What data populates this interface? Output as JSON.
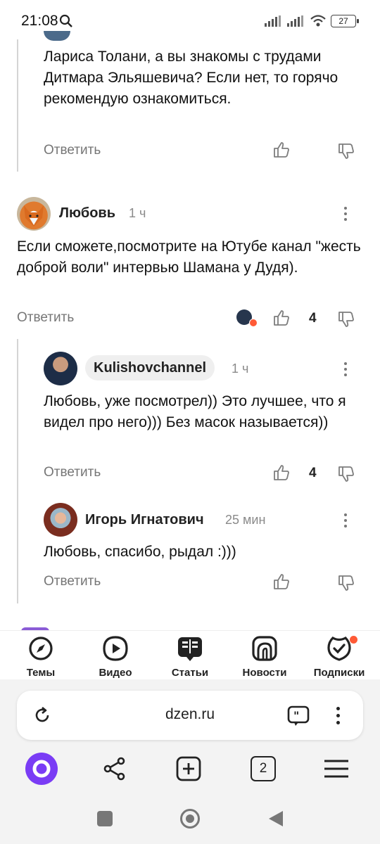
{
  "status_bar": {
    "time": "21:08",
    "battery": "27"
  },
  "comments": {
    "top_reply": {
      "text": "Лариса Толани, а вы знакомы с трудами Дитмара Эльяшевича? Если нет, то горячо рекомендую ознакомиться.",
      "reply_label": "Ответить"
    },
    "lyubov": {
      "author": "Любовь",
      "time_ago": "1 ч",
      "text": "Если сможете,посмотрите на Ютубе канал \"жесть доброй воли\" интервью Шамана у Дудя).",
      "reply_label": "Ответить",
      "likes": "4"
    },
    "kulishov": {
      "author": "Kulishovchannel",
      "time_ago": "1 ч",
      "text": "Любовь, уже посмотрел)) Это лучшее, что я видел про него))) Без масок называется))",
      "reply_label": "Ответить",
      "likes": "4"
    },
    "igor": {
      "author": "Игорь Игнатович",
      "time_ago": "25 мин",
      "text": "Любовь, спасибо, рыдал :)))",
      "reply_label": "Ответить"
    }
  },
  "bottom_nav": {
    "items": [
      {
        "label": "Темы",
        "icon": "compass-icon"
      },
      {
        "label": "Видео",
        "icon": "play-icon"
      },
      {
        "label": "Статьи",
        "icon": "articles-icon"
      },
      {
        "label": "Новости",
        "icon": "news-icon"
      },
      {
        "label": "Подписки",
        "icon": "subscriptions-icon"
      }
    ]
  },
  "browser": {
    "url": "dzen.ru",
    "tab_count": "2"
  },
  "colors": {
    "alice_purple": "#7a3cf5",
    "notification_dot": "#ff5a36",
    "muted_text": "#767676"
  }
}
